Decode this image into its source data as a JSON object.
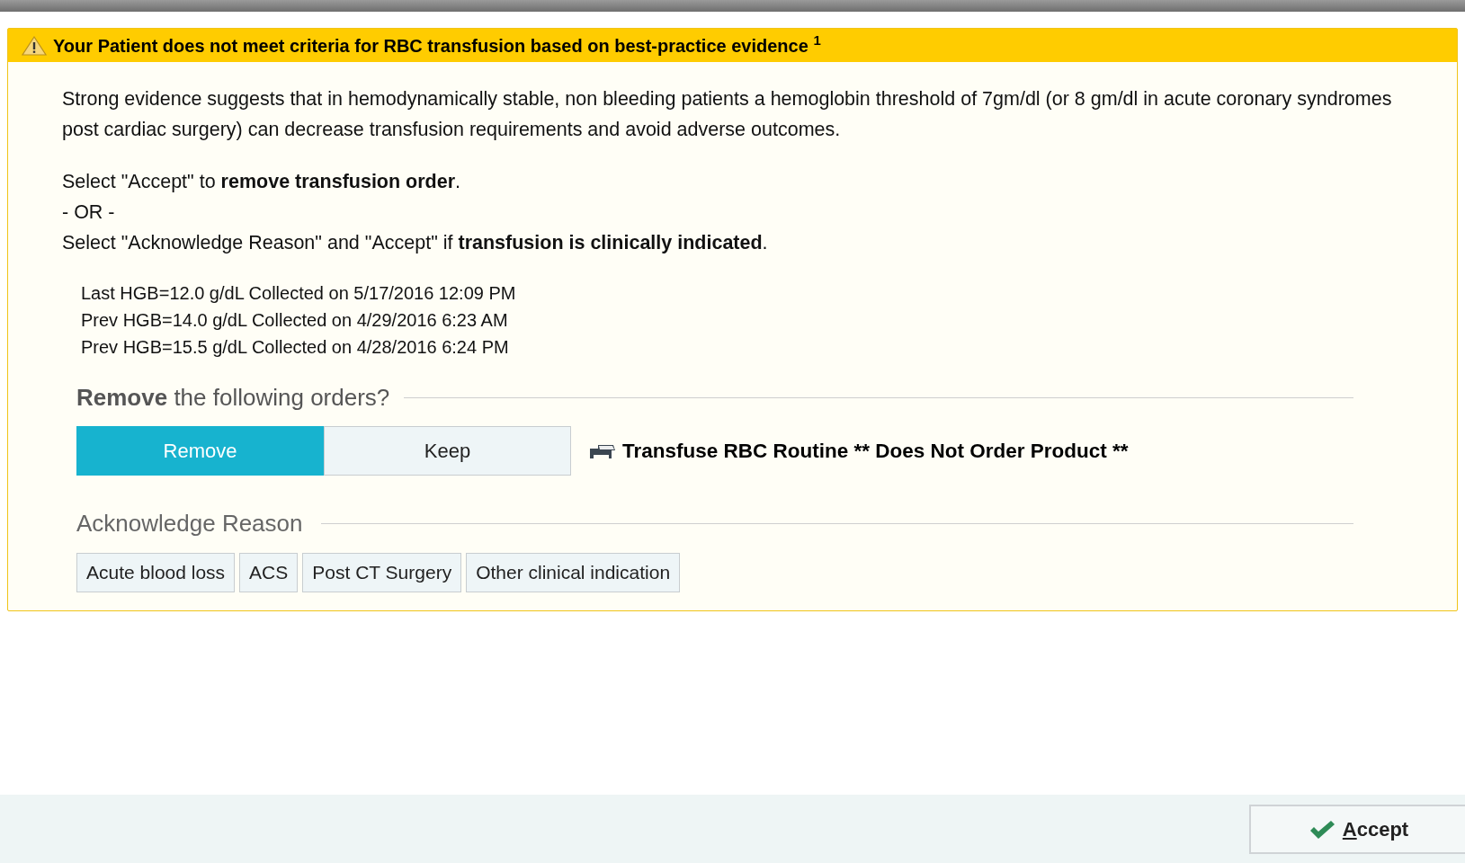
{
  "alert": {
    "title": "Your Patient does not meet criteria for RBC transfusion based on best-practice evidence $^{1}$",
    "paragraphs": [
      "Strong evidence suggests that in hemodynamically stable, non bleeding patients a hemoglobin threshold of 7gm/dl (or 8 gm/dl in acute coronary syndromes post cardiac surgery) can decrease transfusion requirements and avoid adverse outcomes."
    ],
    "instructions": [
      "Select \"Accept\" to **remove transfusion order**.",
      "- OR -",
      "Select \"Acknowledge Reason\" and \"Accept\" if **transfusion is clinically indicated**."
    ],
    "lab_results": [
      "Last HGB=12.0 g/dL Collected on 5/17/2016 12:09 PM",
      "Prev HGB=14.0 g/dL Collected on 4/29/2016 6:23 AM",
      "Prev HGB=15.5 g/dL Collected on 4/28/2016 6:24 PM"
    ],
    "remove_section": {
      "heading": "**Remove** the following orders?",
      "options": [
        {
          "label": "Remove",
          "selected": true
        },
        {
          "label": "Keep",
          "selected": false
        }
      ],
      "order": "Transfuse RBC Routine ** Does Not Order Product **"
    },
    "reason_section": {
      "heading": "Acknowledge Reason",
      "reasons": [
        {
          "label": "Acute blood loss",
          "selected": false
        },
        {
          "label": "ACS",
          "selected": false
        },
        {
          "label": "Post CT Surgery",
          "selected": false
        },
        {
          "label": "Other clinical indication",
          "selected": false
        }
      ]
    }
  },
  "footer": {
    "accept_button": "Accept"
  }
}
